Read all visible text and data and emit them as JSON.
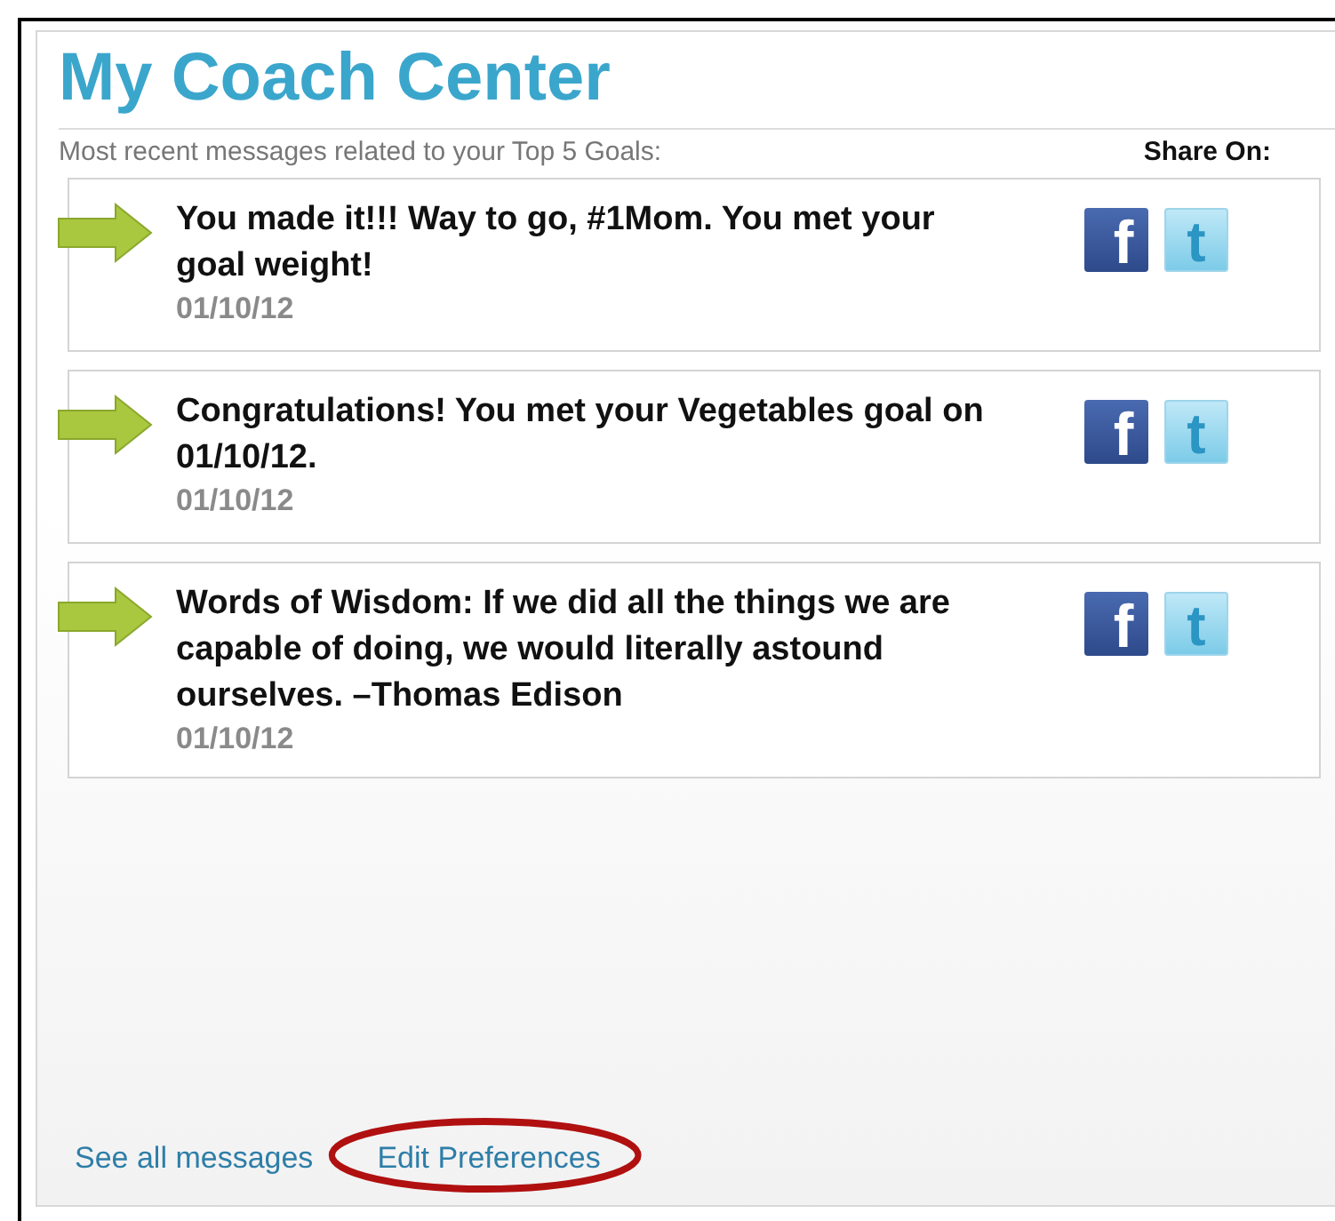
{
  "title": "My Coach Center",
  "subtitle": "Most recent messages related to your Top 5 Goals:",
  "share_label": "Share On:",
  "messages": [
    {
      "text": "You made it!!! Way to go, #1Mom. You met your goal weight!",
      "date": "01/10/12",
      "share": [
        {
          "kind": "facebook",
          "glyph": "f"
        },
        {
          "kind": "twitter",
          "glyph": "t"
        }
      ]
    },
    {
      "text": "Congratulations! You met your Vegetables goal on 01/10/12.",
      "date": "01/10/12",
      "share": [
        {
          "kind": "facebook",
          "glyph": "f"
        },
        {
          "kind": "twitter",
          "glyph": "t"
        }
      ]
    },
    {
      "text": "Words of Wisdom: If we did all the things we are capable of doing, we would literally astound ourselves. –Thomas Edison",
      "date": "01/10/12",
      "share": [
        {
          "kind": "facebook",
          "glyph": "f"
        },
        {
          "kind": "twitter",
          "glyph": "t"
        }
      ]
    }
  ],
  "footer_links": [
    {
      "label": "See all messages",
      "circled": false
    },
    {
      "label": "Edit Preferences",
      "circled": true
    }
  ]
}
